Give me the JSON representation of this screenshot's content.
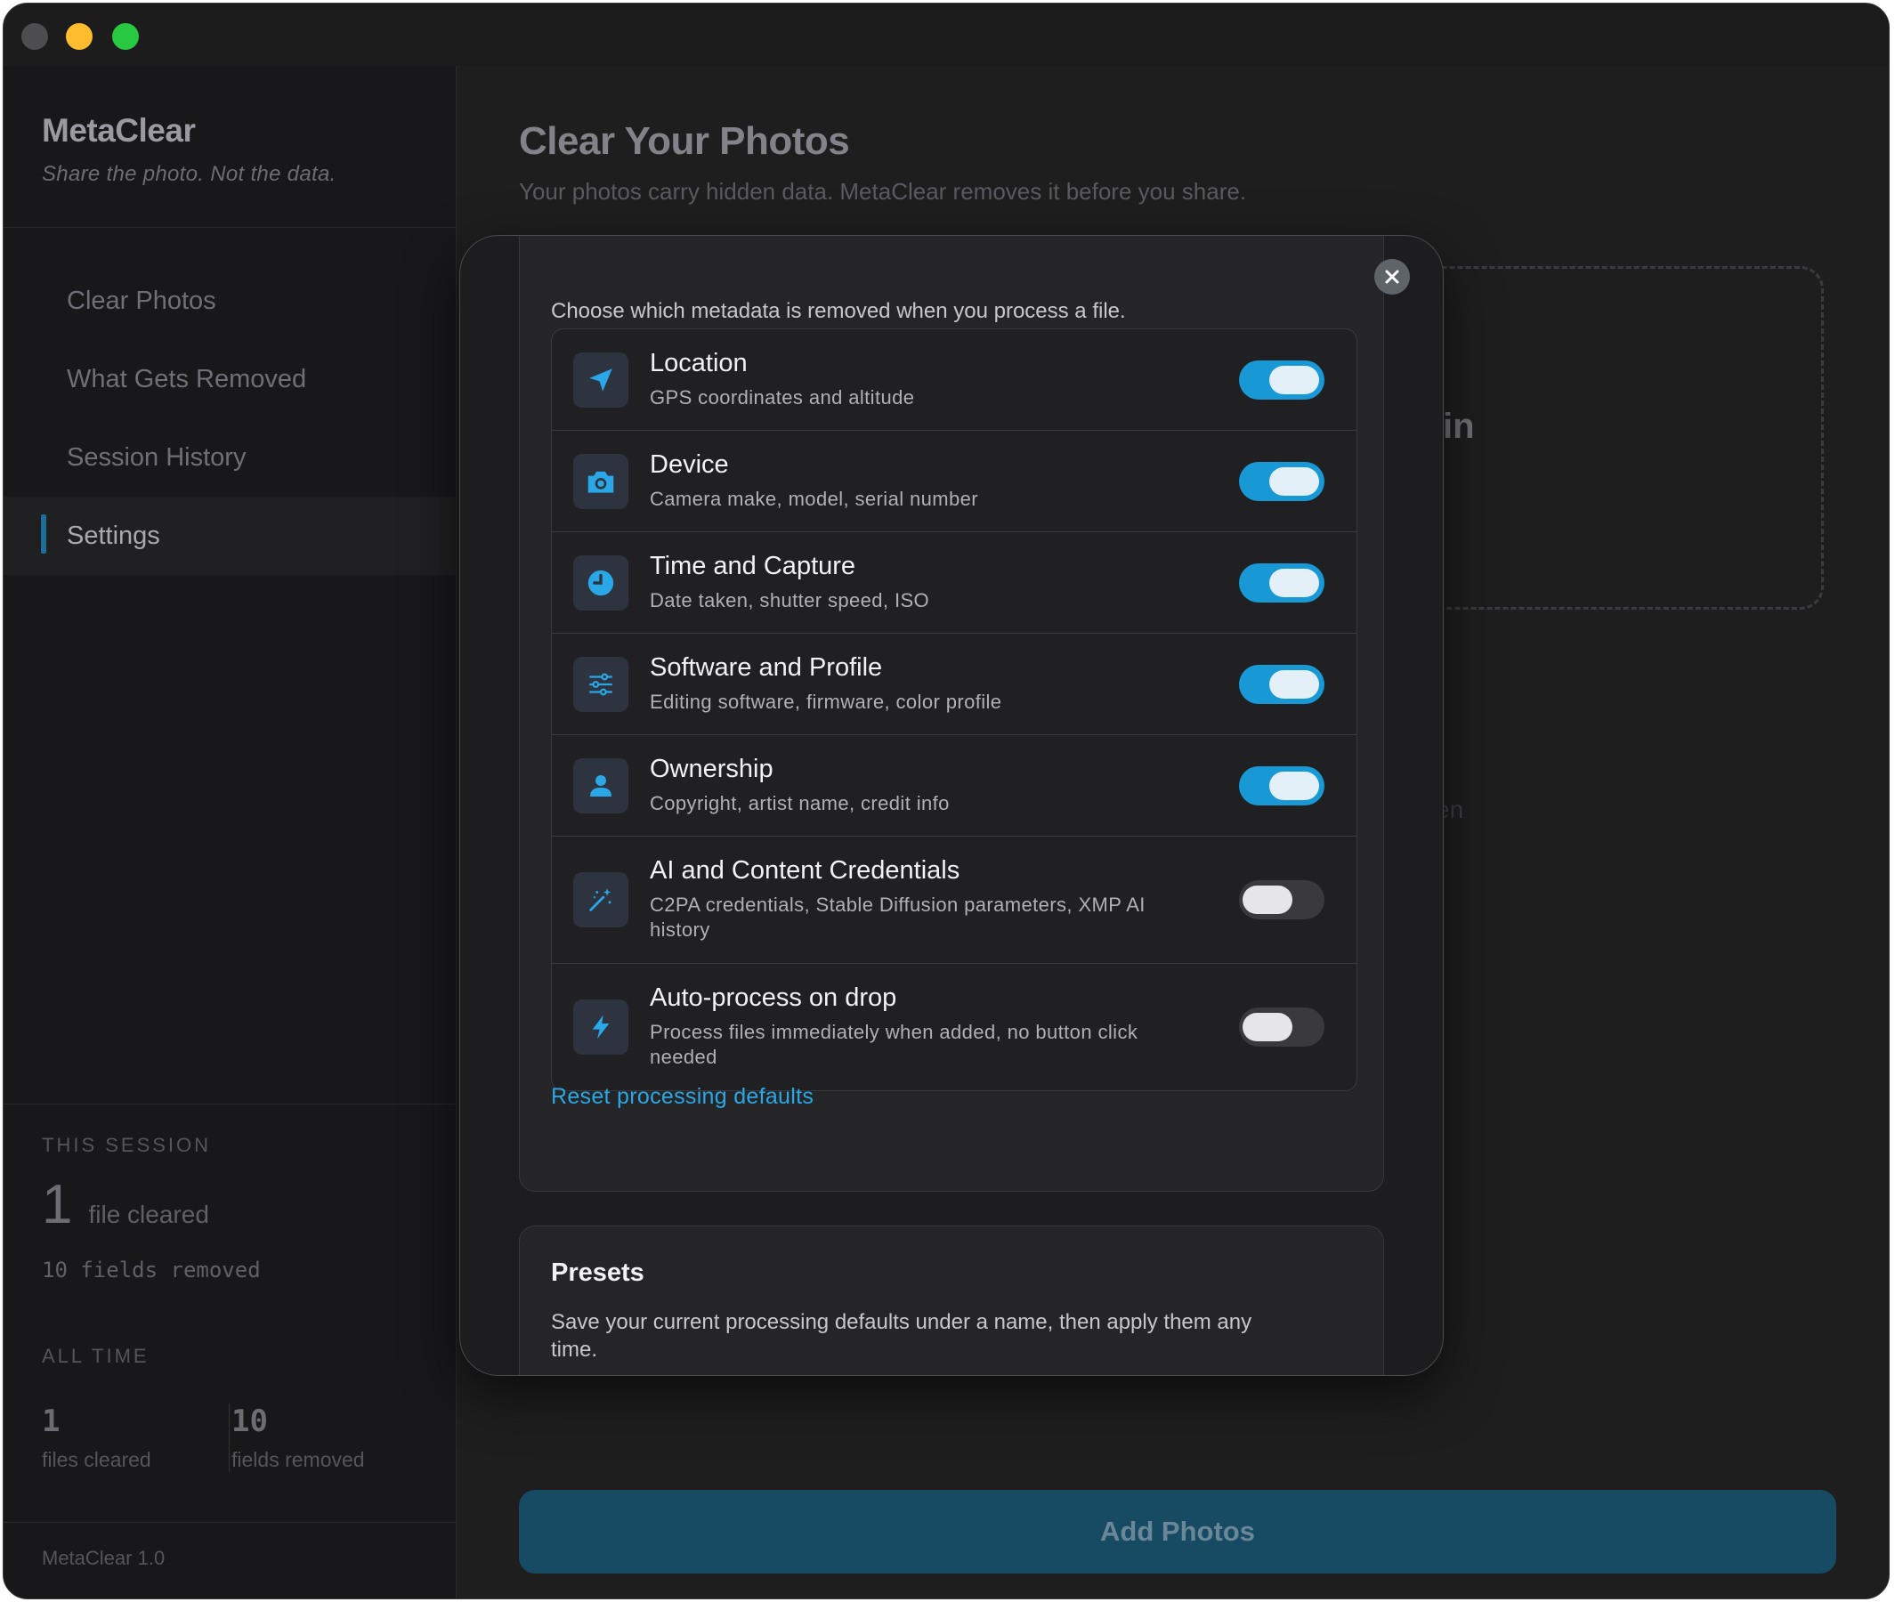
{
  "app": {
    "name": "MetaClear",
    "tagline": "Share the photo. Not the data.",
    "version": "MetaClear 1.0"
  },
  "sidebar": {
    "items": [
      {
        "label": "Clear Photos",
        "active": false
      },
      {
        "label": "What Gets Removed",
        "active": false
      },
      {
        "label": "Session History",
        "active": false
      },
      {
        "label": "Settings",
        "active": true
      }
    ],
    "this_session": {
      "heading": "THIS SESSION",
      "count": "1",
      "count_label": "file cleared",
      "fields": "10 fields removed"
    },
    "all_time": {
      "heading": "ALL TIME",
      "files": "1",
      "files_label": "files cleared",
      "fields": "10",
      "fields_label": "fields removed"
    }
  },
  "main": {
    "title": "Clear Your Photos",
    "subtitle": "Your photos carry hidden data. MetaClear removes it before you share.",
    "dropzone_fragment": "in",
    "ghost_fragment": "en",
    "add_button": "Add Photos"
  },
  "modal": {
    "intro": "Choose which metadata is removed when you process a file.",
    "options": [
      {
        "title": "Location",
        "desc": "GPS coordinates and altitude",
        "icon": "location-arrow-icon",
        "enabled": true
      },
      {
        "title": "Device",
        "desc": "Camera make, model, serial number",
        "icon": "camera-icon",
        "enabled": true
      },
      {
        "title": "Time and Capture",
        "desc": "Date taken, shutter speed, ISO",
        "icon": "clock-icon",
        "enabled": true
      },
      {
        "title": "Software and Profile",
        "desc": "Editing software, firmware, color profile",
        "icon": "sliders-icon",
        "enabled": true
      },
      {
        "title": "Ownership",
        "desc": "Copyright, artist name, credit info",
        "icon": "person-icon",
        "enabled": true
      },
      {
        "title": "AI and Content Credentials",
        "desc": "C2PA credentials, Stable Diffusion parameters, XMP AI history",
        "icon": "magic-wand-icon",
        "enabled": false
      },
      {
        "title": "Auto-process on drop",
        "desc": "Process files immediately when added, no button click needed",
        "icon": "lightning-icon",
        "enabled": false
      }
    ],
    "reset_label": "Reset processing defaults",
    "presets": {
      "title": "Presets",
      "desc": "Save your current processing defaults under a name, then apply them any time."
    }
  },
  "colors": {
    "accent": "#1899d6",
    "link": "#2aa7e6",
    "button_bg": "#174b63"
  }
}
